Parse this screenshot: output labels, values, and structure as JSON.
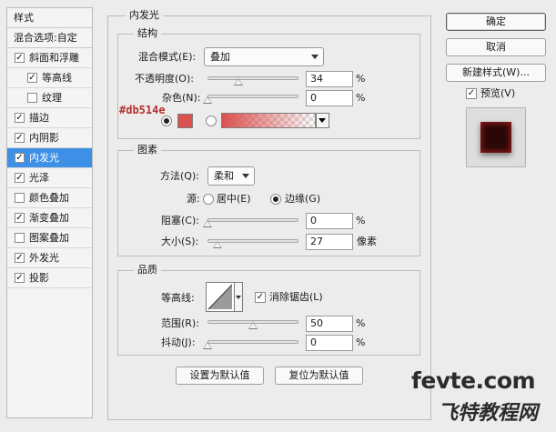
{
  "left_panel": {
    "title": "样式",
    "blend_options": "混合选项:自定",
    "items": [
      {
        "label": "斜面和浮雕",
        "checked": true,
        "indent": false,
        "selected": false
      },
      {
        "label": "等高线",
        "checked": true,
        "indent": true,
        "selected": false
      },
      {
        "label": "纹理",
        "checked": false,
        "indent": true,
        "selected": false
      },
      {
        "label": "描边",
        "checked": true,
        "indent": false,
        "selected": false
      },
      {
        "label": "内阴影",
        "checked": true,
        "indent": false,
        "selected": false
      },
      {
        "label": "内发光",
        "checked": true,
        "indent": false,
        "selected": true
      },
      {
        "label": "光泽",
        "checked": true,
        "indent": false,
        "selected": false
      },
      {
        "label": "颜色叠加",
        "checked": false,
        "indent": false,
        "selected": false
      },
      {
        "label": "渐变叠加",
        "checked": true,
        "indent": false,
        "selected": false
      },
      {
        "label": "图案叠加",
        "checked": false,
        "indent": false,
        "selected": false
      },
      {
        "label": "外发光",
        "checked": true,
        "indent": false,
        "selected": false
      },
      {
        "label": "投影",
        "checked": true,
        "indent": false,
        "selected": false
      }
    ]
  },
  "panel": {
    "title": "内发光",
    "structure": {
      "title": "结构",
      "blend_mode_label": "混合模式(E):",
      "blend_mode_value": "叠加",
      "opacity_label": "不透明度(O):",
      "opacity_value": "34",
      "opacity_unit": "%",
      "opacity_level": 0.34,
      "noise_label": "杂色(N):",
      "noise_value": "0",
      "noise_unit": "%",
      "noise_level": 0,
      "color_hex": "#db514e",
      "color_swatch": "#db514e"
    },
    "elements": {
      "title": "图素",
      "method_label": "方法(Q):",
      "method_value": "柔和",
      "source_label": "源:",
      "source_center": "居中(E)",
      "source_edge": "边缘(G)",
      "choke_label": "阻塞(C):",
      "choke_value": "0",
      "choke_unit": "%",
      "choke_level": 0,
      "size_label": "大小(S):",
      "size_value": "27",
      "size_unit": "像素",
      "size_level": 0.11
    },
    "quality": {
      "title": "品质",
      "contour_label": "等高线:",
      "antialias_label": "消除锯齿(L)",
      "range_label": "范围(R):",
      "range_value": "50",
      "range_unit": "%",
      "range_level": 0.5,
      "jitter_label": "抖动(J):",
      "jitter_value": "0",
      "jitter_unit": "%",
      "jitter_level": 0
    },
    "set_default": "设置为默认值",
    "reset_default": "复位为默认值"
  },
  "right_panel": {
    "ok": "确定",
    "cancel": "取消",
    "new_style": "新建样式(W)...",
    "preview": "预览(V)"
  },
  "watermark": {
    "line1": "fevte.com",
    "line2": "飞特教程网"
  }
}
